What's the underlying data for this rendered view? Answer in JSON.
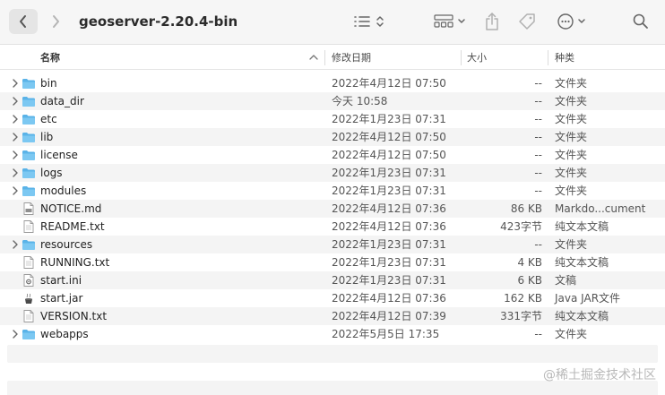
{
  "toolbar": {
    "title": "geoserver-2.20.4-bin",
    "back_icon": "chevron-left-icon",
    "forward_icon": "chevron-right-icon",
    "view_icon": "list-view-icon",
    "group_icon": "grid-group-icon",
    "share_icon": "share-icon",
    "tag_icon": "tag-icon",
    "more_icon": "ellipsis-circle-icon",
    "search_icon": "search-icon"
  },
  "columns": {
    "name": "名称",
    "date": "修改日期",
    "size": "大小",
    "kind": "种类"
  },
  "colors": {
    "folder": "#5ab3e8",
    "folder_tab": "#7cc8f2",
    "accent": "#2f8bd8"
  },
  "rows": [
    {
      "name": "bin",
      "date": "2022年4月12日 07:50",
      "size": "--",
      "kind": "文件夹",
      "type": "folder"
    },
    {
      "name": "data_dir",
      "date": "今天 10:58",
      "size": "--",
      "kind": "文件夹",
      "type": "folder"
    },
    {
      "name": "etc",
      "date": "2022年1月23日 07:31",
      "size": "--",
      "kind": "文件夹",
      "type": "folder"
    },
    {
      "name": "lib",
      "date": "2022年4月12日 07:50",
      "size": "--",
      "kind": "文件夹",
      "type": "folder"
    },
    {
      "name": "license",
      "date": "2022年4月12日 07:50",
      "size": "--",
      "kind": "文件夹",
      "type": "folder"
    },
    {
      "name": "logs",
      "date": "2022年1月23日 07:31",
      "size": "--",
      "kind": "文件夹",
      "type": "folder"
    },
    {
      "name": "modules",
      "date": "2022年1月23日 07:31",
      "size": "--",
      "kind": "文件夹",
      "type": "folder"
    },
    {
      "name": "NOTICE.md",
      "date": "2022年4月12日 07:36",
      "size": "86 KB",
      "kind": "Markdo...cument",
      "type": "md"
    },
    {
      "name": "README.txt",
      "date": "2022年4月12日 07:36",
      "size": "423字节",
      "kind": "纯文本文稿",
      "type": "txt"
    },
    {
      "name": "resources",
      "date": "2022年1月23日 07:31",
      "size": "--",
      "kind": "文件夹",
      "type": "folder"
    },
    {
      "name": "RUNNING.txt",
      "date": "2022年1月23日 07:31",
      "size": "4 KB",
      "kind": "纯文本文稿",
      "type": "txt"
    },
    {
      "name": "start.ini",
      "date": "2022年1月23日 07:31",
      "size": "6 KB",
      "kind": "文稿",
      "type": "ini"
    },
    {
      "name": "start.jar",
      "date": "2022年4月12日 07:36",
      "size": "162 KB",
      "kind": "Java JAR文件",
      "type": "jar"
    },
    {
      "name": "VERSION.txt",
      "date": "2022年4月12日 07:39",
      "size": "331字节",
      "kind": "纯文本文稿",
      "type": "txt"
    },
    {
      "name": "webapps",
      "date": "2022年5月5日 17:35",
      "size": "--",
      "kind": "文件夹",
      "type": "folder"
    }
  ],
  "watermark": "@稀土掘金技术社区"
}
